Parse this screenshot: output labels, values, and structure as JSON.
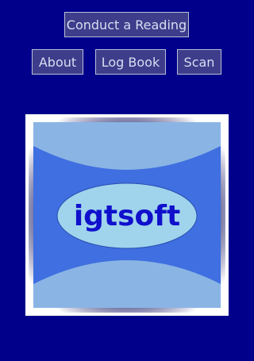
{
  "toolbar": {
    "conduct_reading_label": "Conduct a Reading",
    "about_label": "About",
    "log_book_label": "Log Book",
    "scan_label": "Scan"
  },
  "logo": {
    "text": "igtsoft",
    "colors": {
      "background": "#00008b",
      "frame": "#ffffff",
      "panel_blue": "#3f6fe0",
      "light_blue": "#8ab4e4",
      "oval": "#9fd4ec",
      "text": "#1010cc"
    }
  }
}
